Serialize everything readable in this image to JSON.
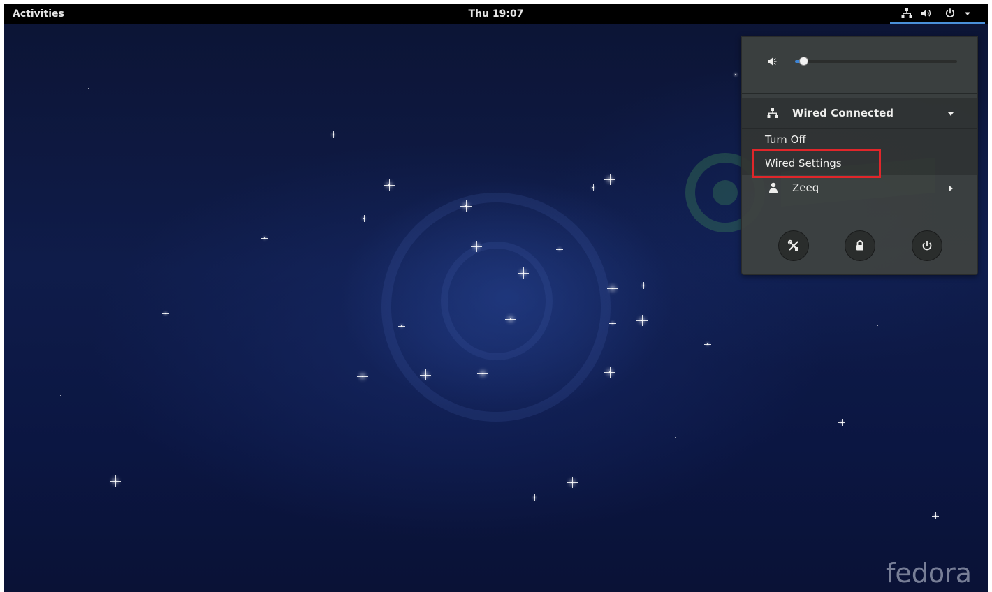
{
  "topbar": {
    "activities_label": "Activities",
    "clock": "Thu 19:07",
    "tray_icons": [
      "network-wired-icon",
      "speaker-volume-icon",
      "power-icon",
      "caret-down-icon"
    ]
  },
  "system_menu": {
    "volume": {
      "icon": "speaker-muted-icon",
      "level": 0.05
    },
    "network": {
      "icon": "network-wired-icon",
      "label": "Wired Connected",
      "expanded": true,
      "items": [
        "Turn Off",
        "Wired Settings"
      ],
      "highlighted_item": "Wired Settings"
    },
    "user": {
      "icon": "user-icon",
      "name": "Zeeq"
    },
    "action_buttons": [
      "settings-icon",
      "lock-icon",
      "power-off-icon"
    ]
  },
  "wallpaper": {
    "logo_text": "fedora"
  },
  "colors": {
    "highlight_border": "#e0262a",
    "accent": "#3d84d4",
    "menu_background": "#3e4240"
  }
}
